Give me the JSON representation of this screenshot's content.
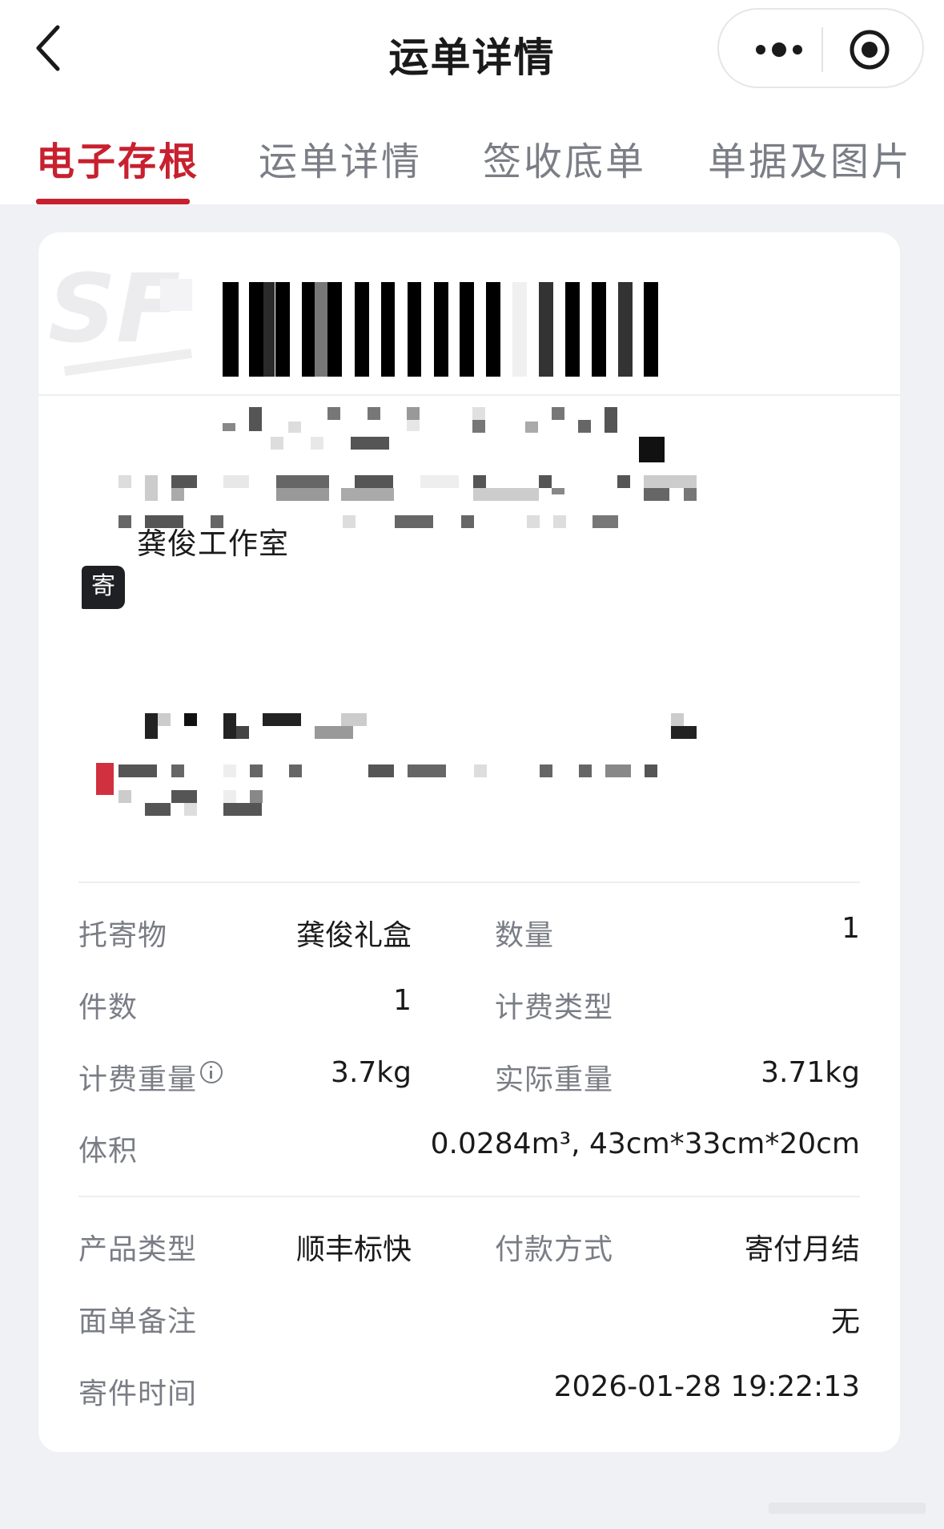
{
  "header": {
    "title": "运单详情",
    "back_icon": "chevron-left-icon",
    "more_icon": "more-dots-icon",
    "close_icon": "target-close-icon"
  },
  "tabs": [
    {
      "label": "电子存根",
      "active": true
    },
    {
      "label": "运单详情",
      "active": false
    },
    {
      "label": "签收底单",
      "active": false
    },
    {
      "label": "单据及图片",
      "active": false
    }
  ],
  "colors": {
    "accent": "#c8202f",
    "page_bg": "#f0f1f5",
    "label_gray": "#7a7d85"
  },
  "sender": {
    "name": "龚俊工作室",
    "badge": "寄"
  },
  "shipment": {
    "cargo_label": "托寄物",
    "cargo_value": "龚俊礼盒",
    "quantity_label": "数量",
    "quantity_value": "1",
    "pieces_label": "件数",
    "pieces_value": "1",
    "billing_type_label": "计费类型",
    "billing_type_value": "",
    "billed_weight_label": "计费重量",
    "billed_weight_value": "3.7kg",
    "actual_weight_label": "实际重量",
    "actual_weight_value": "3.71kg",
    "volume_label": "体积",
    "volume_value": "0.0284m³, 43cm*33cm*20cm",
    "product_label": "产品类型",
    "product_value": "顺丰标快",
    "payment_label": "付款方式",
    "payment_value": "寄付月结",
    "remark_label": "面单备注",
    "remark_value": "无",
    "time_label": "寄件时间",
    "time_value": "2026-01-28 19:22:13"
  }
}
